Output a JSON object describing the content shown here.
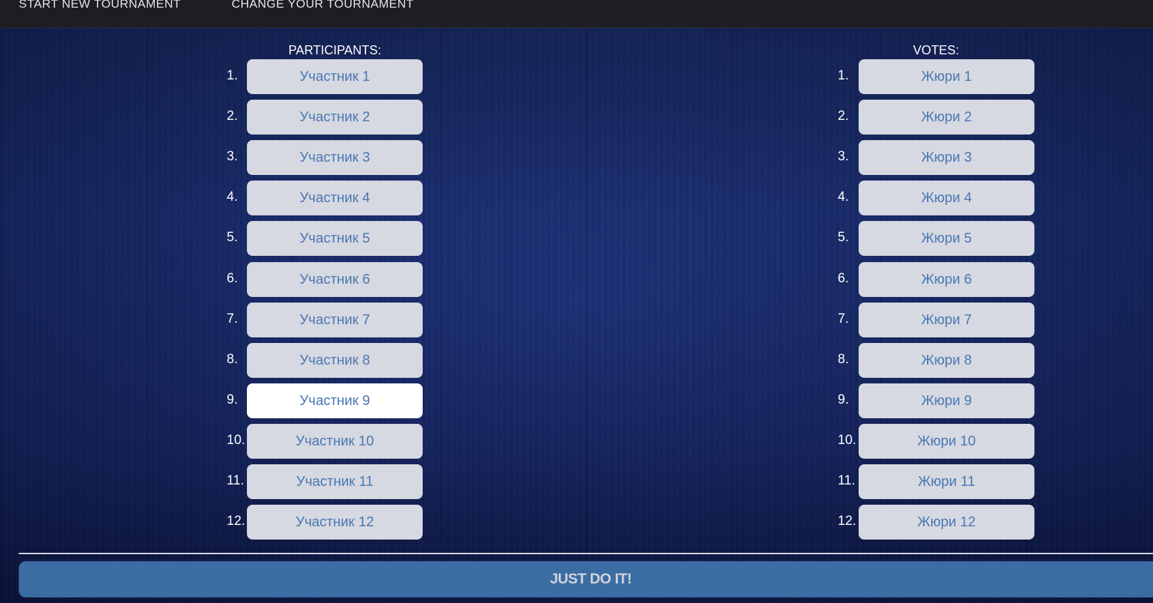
{
  "nav": {
    "start_new": "START NEW TOURNAMENT",
    "change": "CHANGE YOUR TOURNAMENT"
  },
  "participants": {
    "header": "PARTICIPANTS:",
    "items": [
      {
        "num": "1.",
        "label": "Участник 1"
      },
      {
        "num": "2.",
        "label": "Участник 2"
      },
      {
        "num": "3.",
        "label": "Участник 3"
      },
      {
        "num": "4.",
        "label": "Участник 4"
      },
      {
        "num": "5.",
        "label": "Участник 5"
      },
      {
        "num": "6.",
        "label": "Участник 6"
      },
      {
        "num": "7.",
        "label": "Участник 7"
      },
      {
        "num": "8.",
        "label": "Участник 8"
      },
      {
        "num": "9.",
        "label": "Участник 9"
      },
      {
        "num": "10.",
        "label": "Участник 10"
      },
      {
        "num": "11.",
        "label": "Участник 11"
      },
      {
        "num": "12.",
        "label": "Участник 12"
      }
    ],
    "active_index": 8
  },
  "votes": {
    "header": "VOTES:",
    "items": [
      {
        "num": "1.",
        "label": "Жюри 1"
      },
      {
        "num": "2.",
        "label": "Жюри 2"
      },
      {
        "num": "3.",
        "label": "Жюри 3"
      },
      {
        "num": "4.",
        "label": "Жюри 4"
      },
      {
        "num": "5.",
        "label": "Жюри 5"
      },
      {
        "num": "6.",
        "label": "Жюри 6"
      },
      {
        "num": "7.",
        "label": "Жюри 7"
      },
      {
        "num": "8.",
        "label": "Жюри 8"
      },
      {
        "num": "9.",
        "label": "Жюри 9"
      },
      {
        "num": "10.",
        "label": "Жюри 10"
      },
      {
        "num": "11.",
        "label": "Жюри 11"
      },
      {
        "num": "12.",
        "label": "Жюри 12"
      }
    ]
  },
  "submit_label": "JUST DO IT!",
  "colors": {
    "topbar": "#1c1e22",
    "button_bg": "#d6d8e2",
    "button_active_bg": "#ffffff",
    "button_text": "#4a78b0",
    "submit_bg": "#3b6ca3"
  }
}
